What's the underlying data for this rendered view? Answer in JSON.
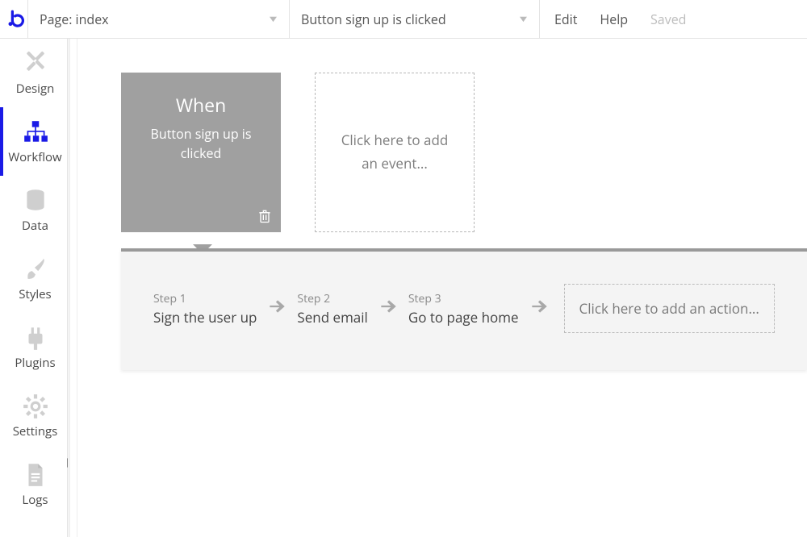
{
  "header": {
    "page_selector": "Page: index",
    "workflow_selector": "Button sign up is clicked",
    "edit": "Edit",
    "help": "Help",
    "saved": "Saved"
  },
  "sidebar": {
    "items": [
      {
        "label": "Design"
      },
      {
        "label": "Workflow"
      },
      {
        "label": "Data"
      },
      {
        "label": "Styles"
      },
      {
        "label": "Plugins"
      },
      {
        "label": "Settings"
      },
      {
        "label": "Logs"
      }
    ],
    "active_index": 1
  },
  "event": {
    "heading": "When",
    "description": "Button sign up is clicked"
  },
  "add_event": "Click here to add an event...",
  "steps": [
    {
      "num": "Step 1",
      "title": "Sign the user up"
    },
    {
      "num": "Step 2",
      "title": "Send email"
    },
    {
      "num": "Step 3",
      "title": "Go to page home"
    }
  ],
  "add_action": "Click here to add an action..."
}
